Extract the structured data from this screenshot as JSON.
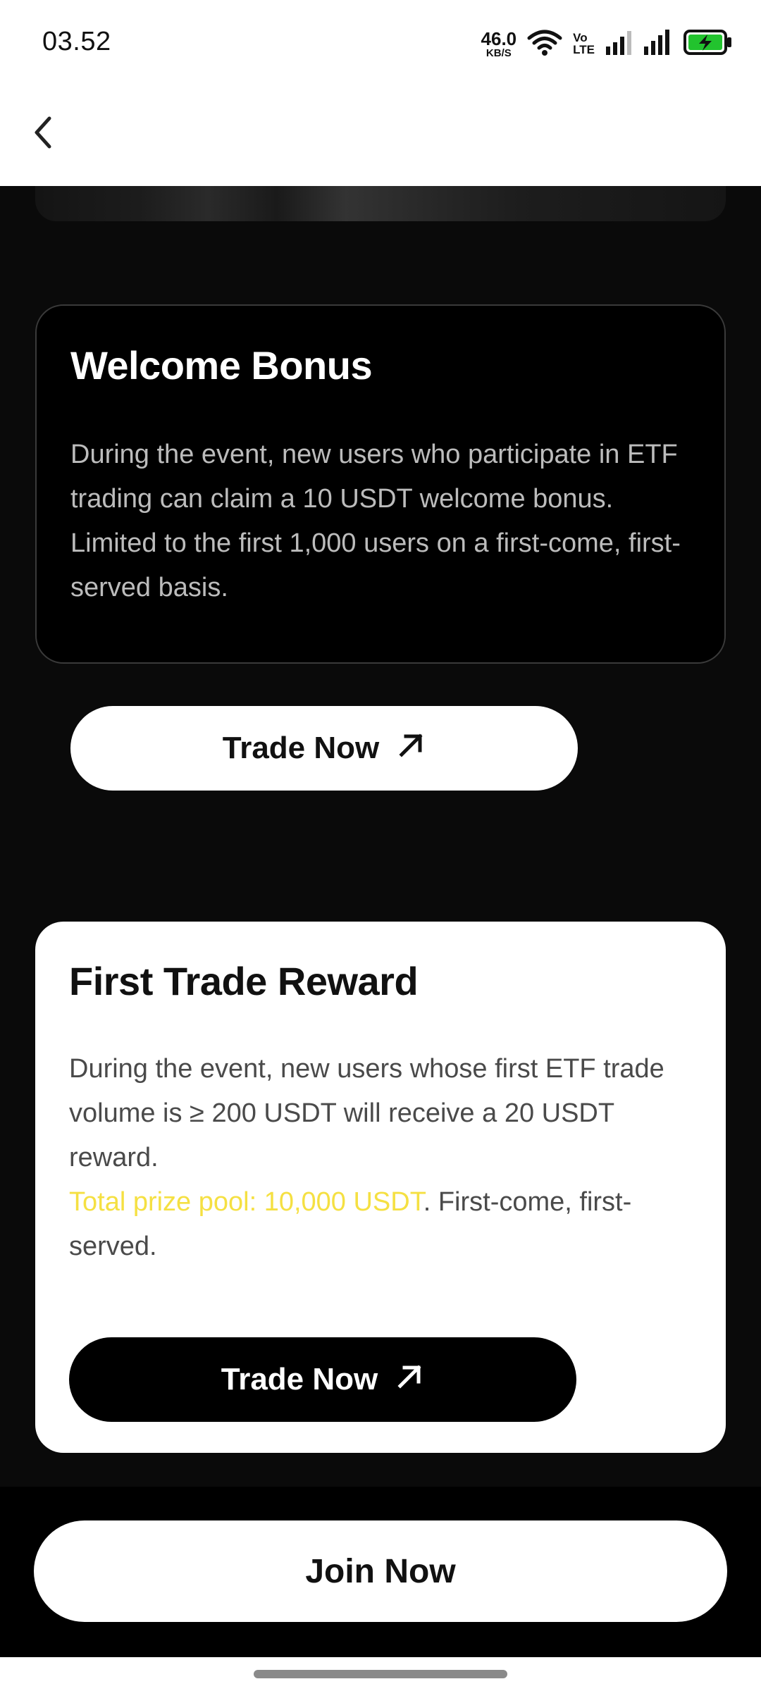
{
  "status_bar": {
    "time": "03.52",
    "net_speed_value": "46.0",
    "net_speed_unit": "KB/S",
    "volte_top": "Vo",
    "volte_bottom": "LTE",
    "battery_color": "#22c32e"
  },
  "header": {
    "back_icon": "chevron-left-icon"
  },
  "cards": [
    {
      "title": "Welcome Bonus",
      "body_lines": [
        "During the event, new users who participate in ETF trading can claim a 10 USDT welcome bonus.",
        "Limited to the first 1,000 users on a first-come, first-served basis."
      ],
      "button_label": "Trade Now",
      "button_icon": "arrow-up-right-icon"
    },
    {
      "title": "First Trade Reward",
      "body_line1": "During the event, new users whose first ETF trade volume is ≥ 200 USDT will receive a 20 USDT reward.",
      "highlight_text": "Total prize pool: 10,000 USDT",
      "highlight_color": "#f5e042",
      "after_highlight": ". First-come, first-served.",
      "button_label": "Trade Now",
      "button_icon": "arrow-up-right-icon"
    }
  ],
  "footer": {
    "join_label": "Join Now"
  }
}
